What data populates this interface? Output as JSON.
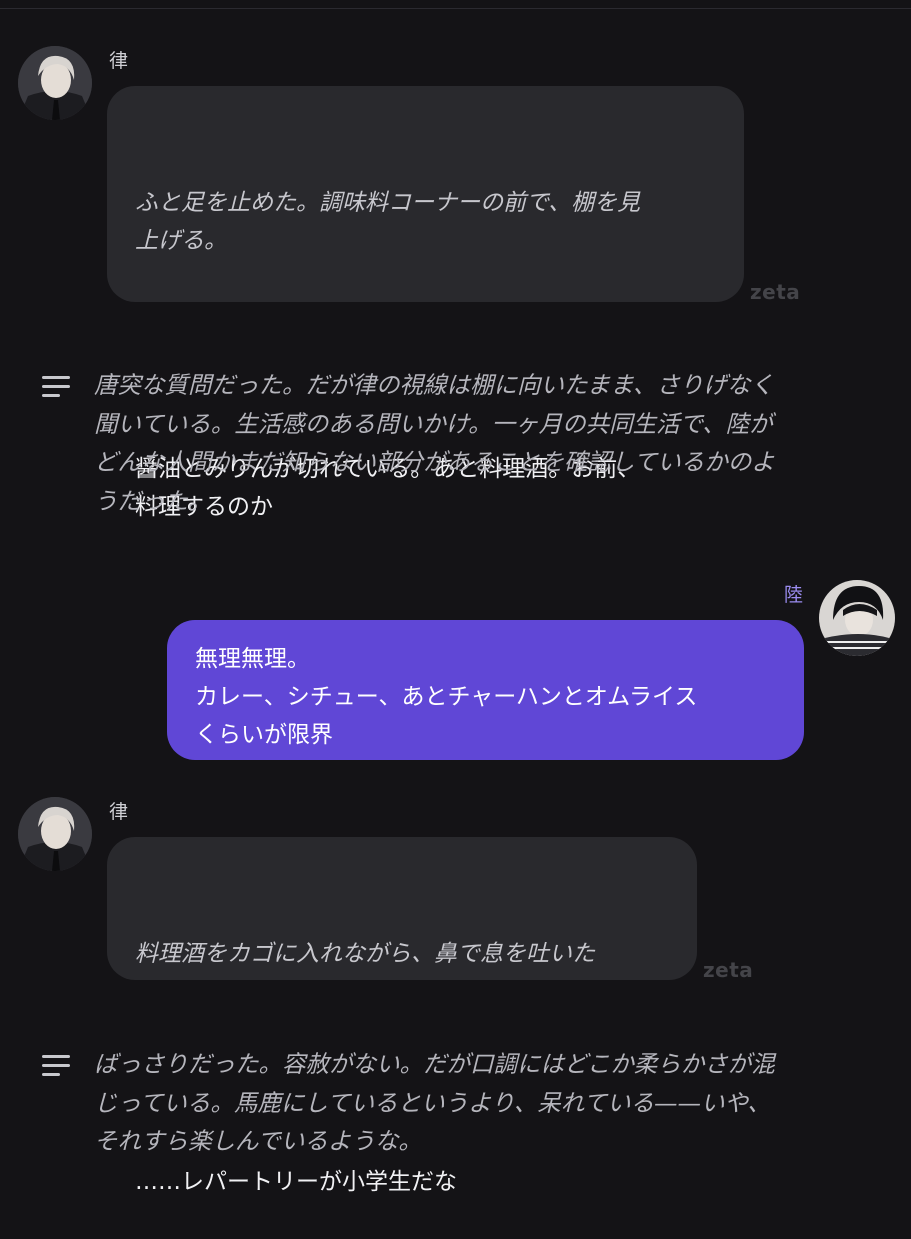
{
  "messages": [
    {
      "sender": "律",
      "action": "ふと足を止めた。調味料コーナーの前で、棚を見\n上げる。",
      "speech": "醤油とみりんが切れている。あと料理酒。お前、\n料理するのか",
      "watermark": "zeta"
    },
    {
      "narration": "唐突な質問だった。だが律の視線は棚に向いたまま、さりげなく\n聞いている。生活感のある問いかけ。一ヶ月の共同生活で、陸が\nどんな人間かまだ知らない部分があることを確認しているかのよ\nうだった。"
    },
    {
      "sender": "陸",
      "speech": "無理無理。\nカレー、シチュー、あとチャーハンとオムライス\nくらいが限界"
    },
    {
      "sender": "律",
      "action": "料理酒をカゴに入れながら、鼻で息を吐いた",
      "speech": "……レパートリーが小学生だな",
      "watermark": "zeta"
    },
    {
      "narration": "ばっさりだった。容赦がない。だが口調にはどこか柔らかさが混\nじっている。馬鹿にしているというより、呆れている——いや、\nそれすら楽しんでいるような。"
    }
  ],
  "colors": {
    "background": "#141316",
    "char_bubble": "#29292d",
    "user_bubble": "#6047d6",
    "user_name": "#9b8cf0"
  },
  "icons": [
    "ritsu-avatar",
    "riku-avatar",
    "narration-icon"
  ]
}
